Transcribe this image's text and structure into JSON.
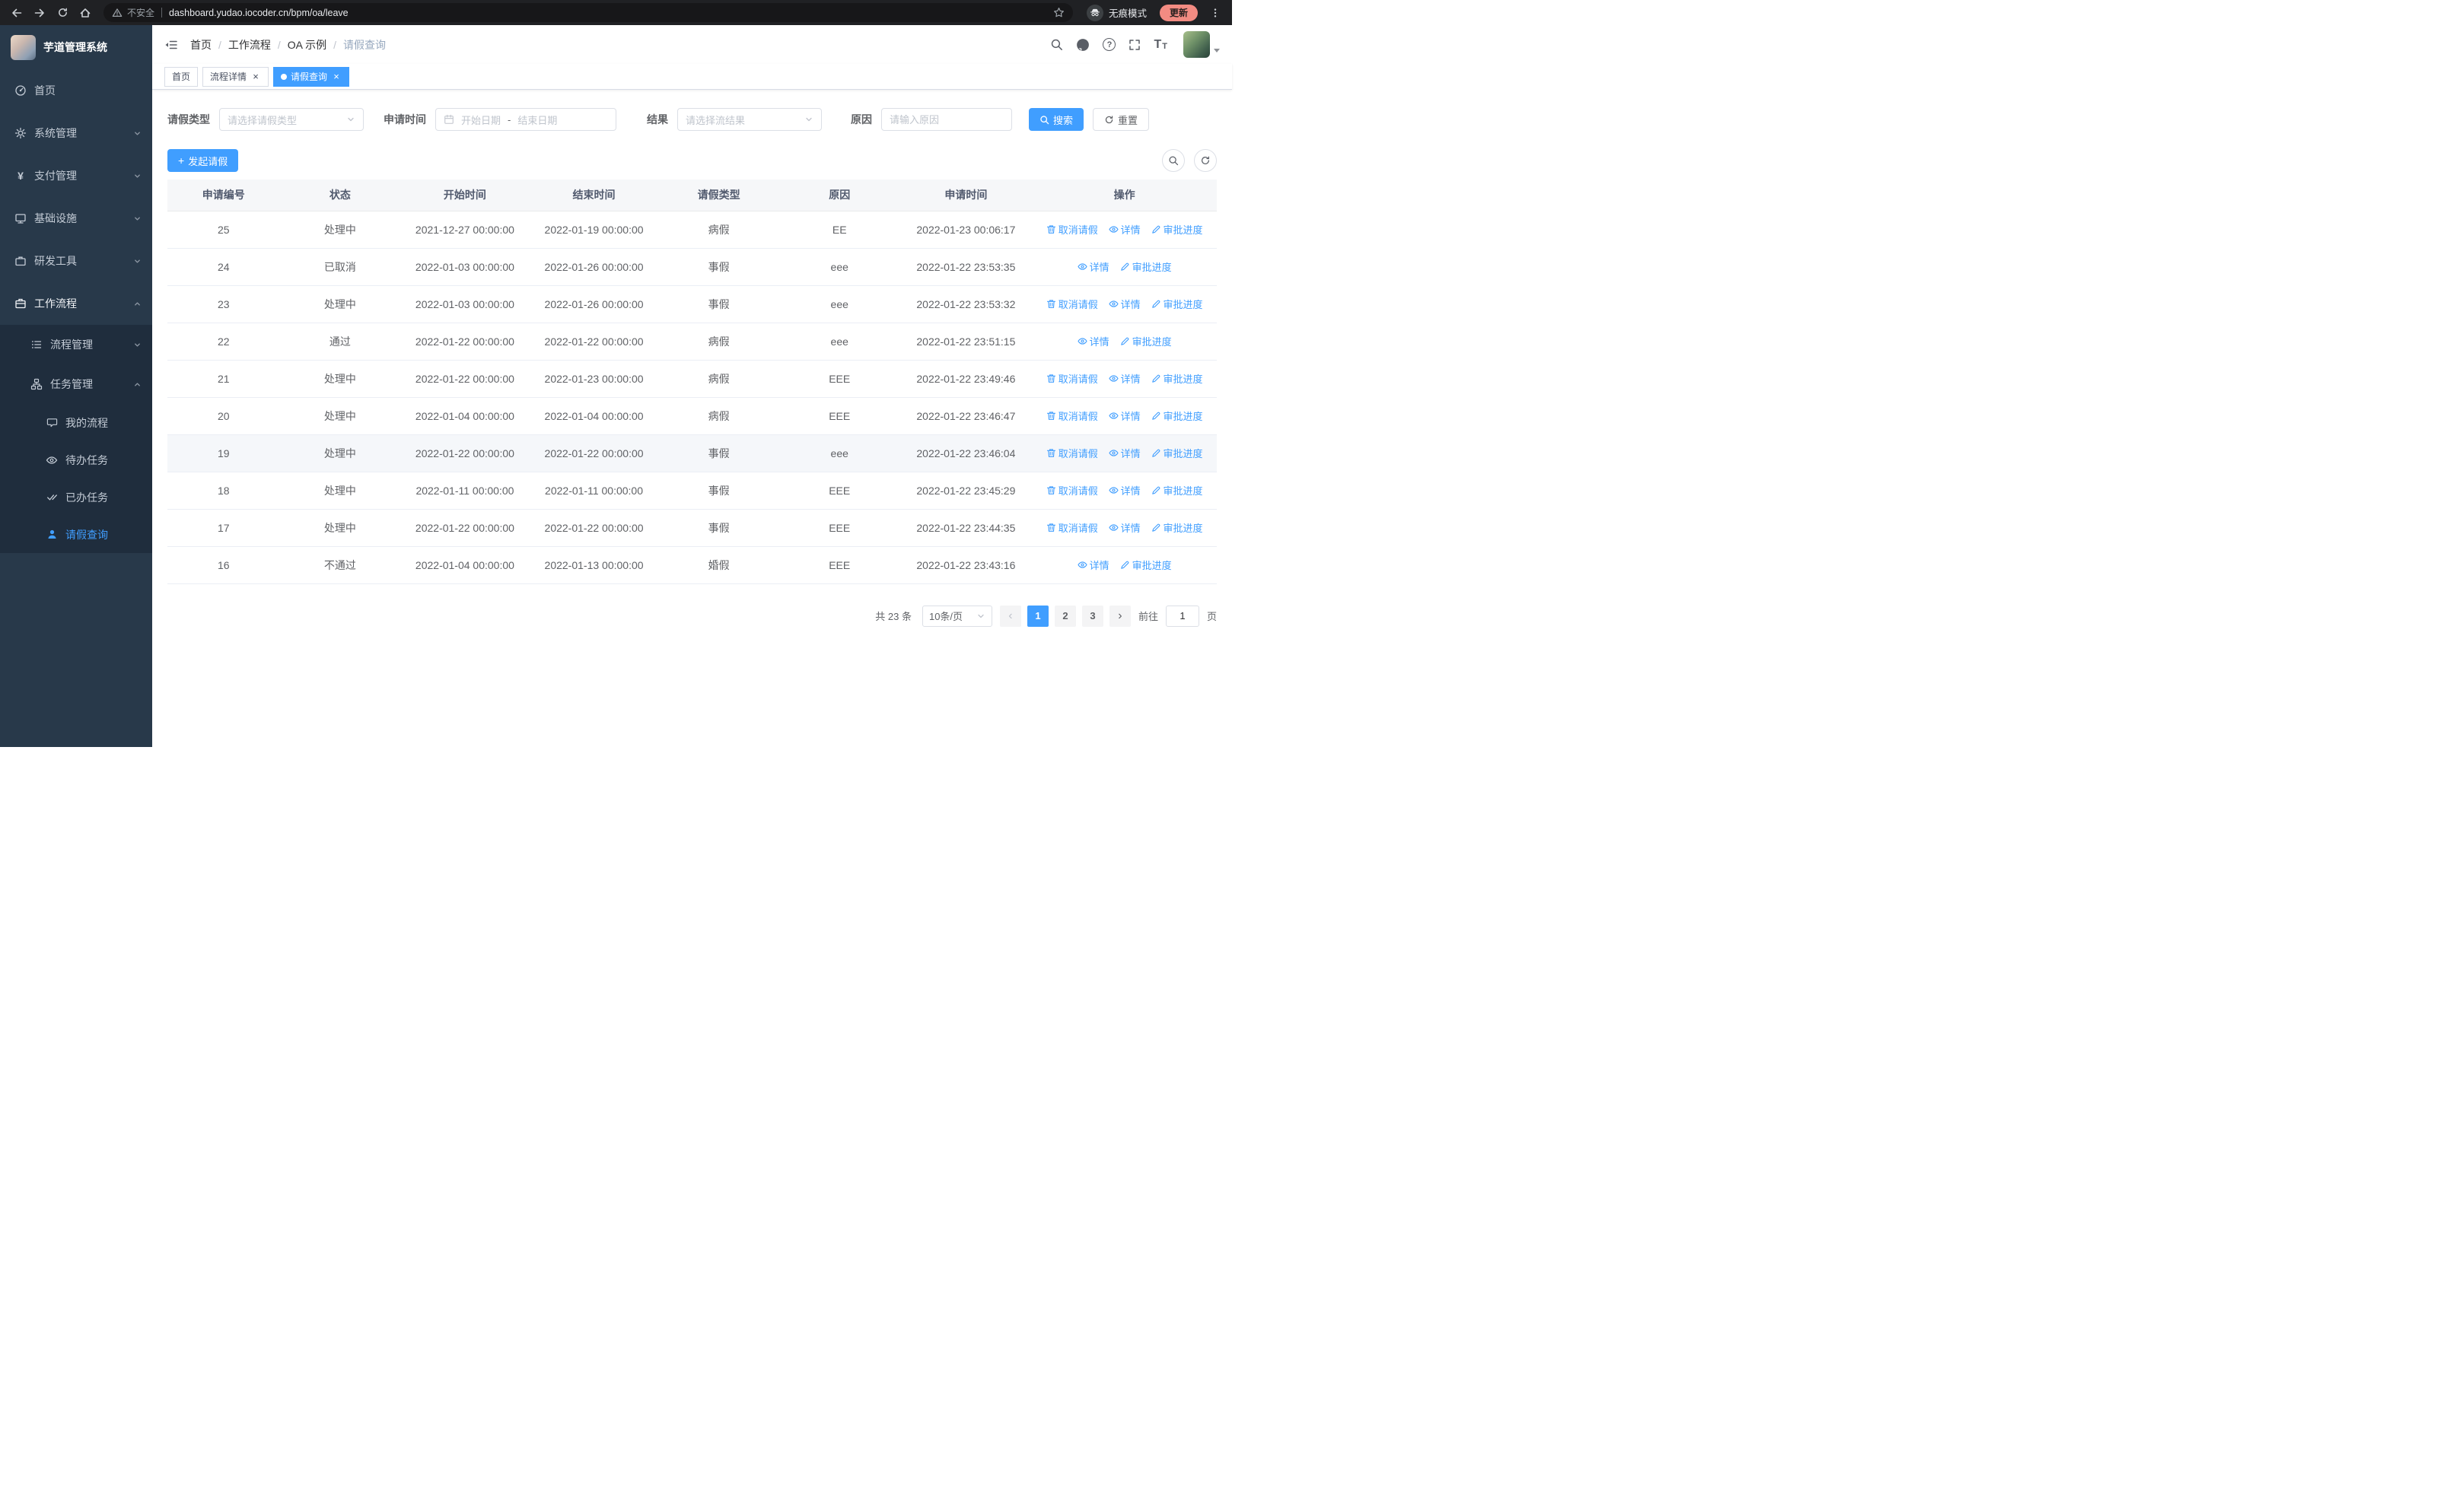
{
  "browser": {
    "security_label": "不安全",
    "url": "dashboard.yudao.iocoder.cn/bpm/oa/leave",
    "incognito_label": "无痕模式",
    "update_label": "更新"
  },
  "sidebar": {
    "logo_title": "芋道管理系统",
    "menu": [
      {
        "label": "首页",
        "icon": "dashboard-icon"
      },
      {
        "label": "系统管理",
        "icon": "gear-icon"
      },
      {
        "label": "支付管理",
        "icon": "yen-icon"
      },
      {
        "label": "基础设施",
        "icon": "monitor-icon"
      },
      {
        "label": "研发工具",
        "icon": "briefcase-icon"
      },
      {
        "label": "工作流程",
        "icon": "workflow-icon"
      },
      {
        "label": "流程管理",
        "icon": "list-icon"
      },
      {
        "label": "任务管理",
        "icon": "org-icon"
      },
      {
        "label": "我的流程",
        "icon": "chat-icon"
      },
      {
        "label": "待办任务",
        "icon": "eye-icon"
      },
      {
        "label": "已办任务",
        "icon": "double-check-icon"
      },
      {
        "label": "请假查询",
        "icon": "user-icon"
      }
    ]
  },
  "header": {
    "breadcrumb": [
      "首页",
      "工作流程",
      "OA 示例",
      "请假查询"
    ],
    "separator": "/"
  },
  "tabs": [
    {
      "label": "首页"
    },
    {
      "label": "流程详情"
    },
    {
      "label": "请假查询"
    }
  ],
  "filters": {
    "type_label": "请假类型",
    "type_placeholder": "请选择请假类型",
    "time_label": "申请时间",
    "start_placeholder": "开始日期",
    "range_separator": "-",
    "end_placeholder": "结束日期",
    "result_label": "结果",
    "result_placeholder": "请选择流结果",
    "reason_label": "原因",
    "reason_placeholder": "请输入原因",
    "search_label": "搜索",
    "reset_label": "重置"
  },
  "toolbar": {
    "create_label": "发起请假"
  },
  "table": {
    "columns": [
      "申请编号",
      "状态",
      "开始时间",
      "结束时间",
      "请假类型",
      "原因",
      "申请时间",
      "操作"
    ],
    "action_labels": {
      "cancel": "取消请假",
      "detail": "详情",
      "progress": "审批进度"
    },
    "rows": [
      {
        "id": "25",
        "status": "处理中",
        "start": "2021-12-27 00:00:00",
        "end": "2022-01-19 00:00:00",
        "type": "病假",
        "reason": "EE",
        "applied": "2022-01-23 00:06:17",
        "actions": [
          "cancel",
          "detail",
          "progress"
        ],
        "highlight": false
      },
      {
        "id": "24",
        "status": "已取消",
        "start": "2022-01-03 00:00:00",
        "end": "2022-01-26 00:00:00",
        "type": "事假",
        "reason": "eee",
        "applied": "2022-01-22 23:53:35",
        "actions": [
          "detail",
          "progress"
        ],
        "highlight": false
      },
      {
        "id": "23",
        "status": "处理中",
        "start": "2022-01-03 00:00:00",
        "end": "2022-01-26 00:00:00",
        "type": "事假",
        "reason": "eee",
        "applied": "2022-01-22 23:53:32",
        "actions": [
          "cancel",
          "detail",
          "progress"
        ],
        "highlight": false
      },
      {
        "id": "22",
        "status": "通过",
        "start": "2022-01-22 00:00:00",
        "end": "2022-01-22 00:00:00",
        "type": "病假",
        "reason": "eee",
        "applied": "2022-01-22 23:51:15",
        "actions": [
          "detail",
          "progress"
        ],
        "highlight": false
      },
      {
        "id": "21",
        "status": "处理中",
        "start": "2022-01-22 00:00:00",
        "end": "2022-01-23 00:00:00",
        "type": "病假",
        "reason": "EEE",
        "applied": "2022-01-22 23:49:46",
        "actions": [
          "cancel",
          "detail",
          "progress"
        ],
        "highlight": false
      },
      {
        "id": "20",
        "status": "处理中",
        "start": "2022-01-04 00:00:00",
        "end": "2022-01-04 00:00:00",
        "type": "病假",
        "reason": "EEE",
        "applied": "2022-01-22 23:46:47",
        "actions": [
          "cancel",
          "detail",
          "progress"
        ],
        "highlight": false
      },
      {
        "id": "19",
        "status": "处理中",
        "start": "2022-01-22 00:00:00",
        "end": "2022-01-22 00:00:00",
        "type": "事假",
        "reason": "eee",
        "applied": "2022-01-22 23:46:04",
        "actions": [
          "cancel",
          "detail",
          "progress"
        ],
        "highlight": true
      },
      {
        "id": "18",
        "status": "处理中",
        "start": "2022-01-11 00:00:00",
        "end": "2022-01-11 00:00:00",
        "type": "事假",
        "reason": "EEE",
        "applied": "2022-01-22 23:45:29",
        "actions": [
          "cancel",
          "detail",
          "progress"
        ],
        "highlight": false
      },
      {
        "id": "17",
        "status": "处理中",
        "start": "2022-01-22 00:00:00",
        "end": "2022-01-22 00:00:00",
        "type": "事假",
        "reason": "EEE",
        "applied": "2022-01-22 23:44:35",
        "actions": [
          "cancel",
          "detail",
          "progress"
        ],
        "highlight": false
      },
      {
        "id": "16",
        "status": "不通过",
        "start": "2022-01-04 00:00:00",
        "end": "2022-01-13 00:00:00",
        "type": "婚假",
        "reason": "EEE",
        "applied": "2022-01-22 23:43:16",
        "actions": [
          "detail",
          "progress"
        ],
        "highlight": false
      }
    ]
  },
  "pagination": {
    "total_text": "共 23 条",
    "page_size": "10条/页",
    "pages": [
      "1",
      "2",
      "3"
    ],
    "active_page": "1",
    "goto_label": "前往",
    "goto_value": "1",
    "goto_suffix": "页"
  }
}
